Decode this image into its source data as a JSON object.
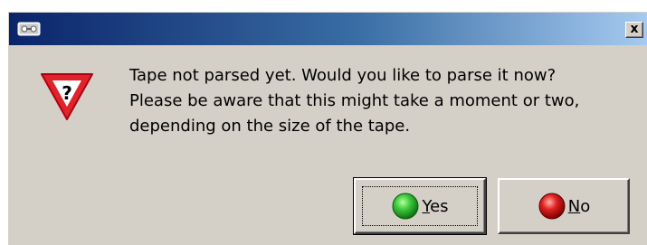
{
  "dialog": {
    "title": "",
    "close_glyph": "x",
    "message_lines": [
      "Tape not parsed yet. Would you like to parse it now?",
      "Please be aware that this might take a moment or two,",
      "depending on the size of the tape."
    ],
    "icon": "warning-question-icon",
    "buttons": {
      "yes": {
        "mnemonic": "Y",
        "rest": "es",
        "icon": "green-ball-icon",
        "color": "#22b022"
      },
      "no": {
        "mnemonic": "N",
        "rest": "o",
        "icon": "red-ball-icon",
        "color": "#d01010"
      }
    }
  },
  "colors": {
    "titlebar_start": "#0a246a",
    "titlebar_end": "#a6caf0",
    "dialog_bg": "#d4d0c8",
    "warning_red": "#e0232b"
  }
}
